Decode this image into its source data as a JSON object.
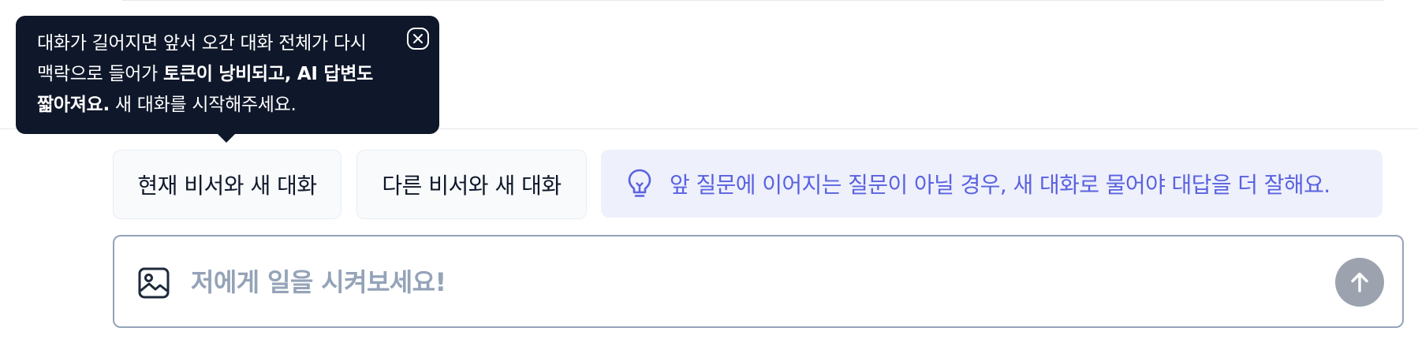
{
  "tooltip": {
    "line1": "대화가 길어지면 앞서 오간 대화 전체가 다시",
    "line2_normal": "맥락으로 들어가 ",
    "line2_bold": "토큰이 낭비되고, AI 답변도",
    "line3_bold": "짧아져요.",
    "line3_normal": " 새 대화를 시작해주세요."
  },
  "actions": {
    "new_chat_current": "현재 비서와 새 대화",
    "new_chat_other": "다른 비서와 새 대화"
  },
  "tip": {
    "text": "앞 질문에 이어지는 질문이 아닐 경우, 새 대화로 물어야 대답을 더 잘해요."
  },
  "composer": {
    "placeholder": "저에게 일을 시켜보세요!",
    "value": ""
  },
  "colors": {
    "tooltip_bg": "#0f172a",
    "tip_bg": "#eef0fc",
    "tip_text": "#5a62e0",
    "placeholder": "#94a3b8",
    "send_button": "#9ca3af"
  },
  "icons": {
    "tooltip_close": "close-icon",
    "tip": "lightbulb-icon",
    "attach": "image-icon",
    "send": "arrow-up-icon"
  }
}
